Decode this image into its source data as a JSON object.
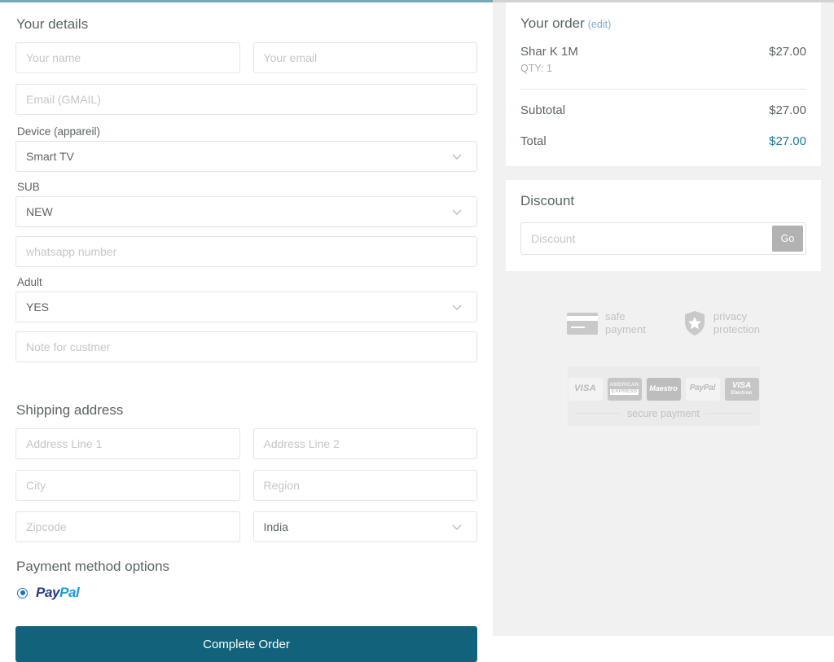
{
  "form": {
    "details_title": "Your details",
    "name_placeholder": "Your name",
    "email_placeholder": "Your email",
    "gmail_placeholder": "Email (GMAIL)",
    "device_label": "Device (appareil)",
    "device_value": "Smart TV",
    "sub_label": "SUB",
    "sub_value": "NEW",
    "whatsapp_placeholder": "whatsapp number",
    "adult_label": "Adult",
    "adult_value": "YES",
    "note_placeholder": "Note for custmer",
    "shipping_title": "Shipping address",
    "address1_placeholder": "Address Line 1",
    "address2_placeholder": "Address Line 2",
    "city_placeholder": "City",
    "region_placeholder": "Region",
    "zipcode_placeholder": "Zipcode",
    "country_value": "India",
    "payment_title": "Payment method options",
    "paypal_pay": "Pay",
    "paypal_pal": "Pal",
    "submit_label": "Complete Order"
  },
  "order": {
    "title": "Your order",
    "edit_label": "(edit)",
    "items": [
      {
        "name": "Shar K 1M",
        "qty": "QTY: 1",
        "price": "$27.00"
      }
    ],
    "subtotal_label": "Subtotal",
    "subtotal_value": "$27.00",
    "total_label": "Total",
    "total_value": "$27.00"
  },
  "discount": {
    "title": "Discount",
    "placeholder": "Discount",
    "go_label": "Go"
  },
  "trust": {
    "safe_line1": "safe",
    "safe_line2": "payment",
    "privacy_line1": "privacy",
    "privacy_line2": "protection",
    "cards": [
      {
        "id": "visa",
        "text": "VISA"
      },
      {
        "id": "amex",
        "line1": "AMERICAN",
        "line2": "EXPRESS"
      },
      {
        "id": "maestro",
        "text": "Maestro"
      },
      {
        "id": "paypal",
        "text": "PayPal"
      },
      {
        "id": "visa-electron",
        "text": "VISA",
        "sub": "Electron"
      }
    ],
    "secure_text": "secure payment"
  },
  "colors": {
    "accent_teal": "#11627a",
    "top_border": "#74a8b4",
    "total_teal": "#1c7a92",
    "link_blue": "#7fa9d6",
    "page_bg": "#f1f1f1"
  }
}
